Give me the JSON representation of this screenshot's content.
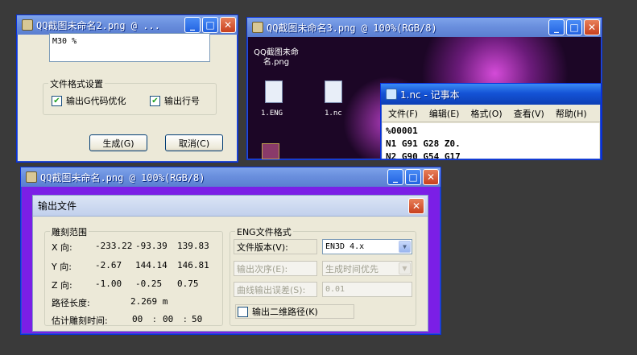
{
  "w2": {
    "title": "QQ截图未命名2.png @ ...",
    "textarea_text": "M30 %",
    "file_format_group": "文件格式设置",
    "chk_optimize": "输出G代码优化",
    "chk_output_line": "输出行号",
    "generate_btn": "生成(G)",
    "cancel_btn": "取消(C)"
  },
  "w3": {
    "title": "QQ截图未命名3.png @ 100%(RGB/8)",
    "desktop_icon_label": "QQ截图未命名.png",
    "file1_label": "1.ENG",
    "file2_label": "1.nc"
  },
  "notepad": {
    "title": "1.nc - 记事本",
    "menu": [
      "文件(F)",
      "编辑(E)",
      "格式(O)",
      "查看(V)",
      "帮助(H)"
    ],
    "lines": [
      "%00001",
      "N1 G91 G28 Z0.",
      "N2 G90 G54 G17"
    ]
  },
  "w1": {
    "title": "QQ截图未命名.png @ 100%(RGB/8)"
  },
  "dlg": {
    "title": "输出文件",
    "range_group": "雕刻范围",
    "rows": [
      {
        "axis": "X 向:",
        "v1": "-233.22",
        "v2": "-93.39",
        "v3": "139.83"
      },
      {
        "axis": "Y 向:",
        "v1": "-2.67",
        "v2": "144.14",
        "v3": "146.81"
      },
      {
        "axis": "Z 向:",
        "v1": "-1.00",
        "v2": "-0.25",
        "v3": "0.75"
      }
    ],
    "path_length_label": "路径长度:",
    "path_length_value": "2.269 m",
    "time_label": "估计雕刻时间:",
    "time_h": "00",
    "time_sep1": ":",
    "time_m": "00",
    "time_sep2": ":",
    "time_s": "50",
    "eng_group": "ENG文件格式",
    "version_label": "文件版本(V):",
    "version_value": "EN3D 4.x",
    "order_label": "输出次序(E):",
    "order_value": "生成时间优先",
    "tolerance_label": "曲线输出误差(S):",
    "tolerance_value": "0.01",
    "chk_2d": "输出二维路径(K)"
  },
  "colors": {
    "xp_blue": "#0d3fb5",
    "purple_canvas": "#7b1fe6",
    "dark_bg": "#3a3a3a"
  }
}
